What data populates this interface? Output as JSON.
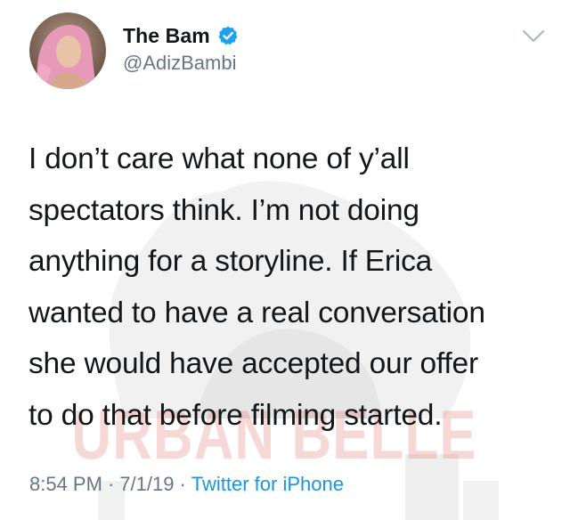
{
  "user": {
    "display_name": "The Bam",
    "handle": "@AdizBambi",
    "verified": true
  },
  "tweet": {
    "lines": [
      "I don’t care what none of y’all",
      "spectators think. I’m not doing",
      "anything for a storyline. If Erica",
      "wanted to have a real conversation",
      "she would have accepted our offer",
      "to do that before filming started."
    ],
    "time": "8:54 PM",
    "date": "7/1/19",
    "separator": "·",
    "source": "Twitter for iPhone"
  },
  "watermark": {
    "text": "URBAN BELLE"
  },
  "colors": {
    "text": "#14171a",
    "secondary": "#657786",
    "link": "#1b95e0",
    "verified": "#1da1f2",
    "watermark": "#d9534f"
  },
  "icons": {
    "verified": "verified-badge-icon",
    "menu": "chevron-down-icon"
  }
}
